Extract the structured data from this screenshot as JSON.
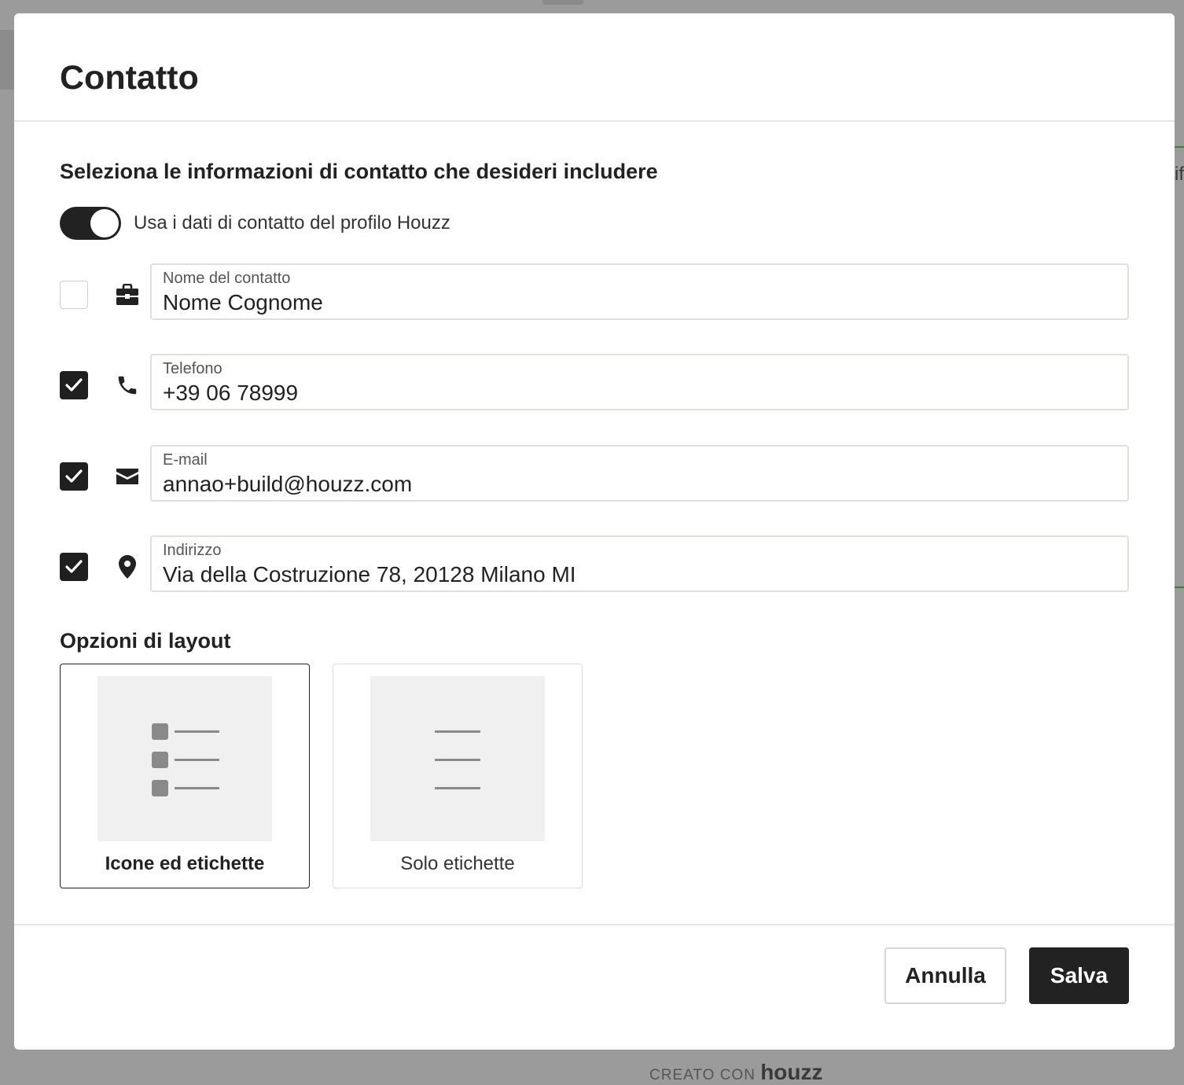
{
  "background": {
    "side_text": "if",
    "footer_prefix": "CREATO CON",
    "footer_brand": "houzz"
  },
  "modal": {
    "title": "Contatto",
    "section_heading": "Seleziona le informazioni di contatto che desideri includere",
    "toggle": {
      "label": "Usa i dati di contatto del profilo Houzz",
      "on": true
    },
    "fields": [
      {
        "label": "Nome del contatto",
        "value": "Nome Cognome",
        "checked": false,
        "icon": "briefcase-icon"
      },
      {
        "label": "Telefono",
        "value": "+39 06 78999",
        "checked": true,
        "icon": "phone-icon"
      },
      {
        "label": "E-mail",
        "value": "annao+build@houzz.com",
        "checked": true,
        "icon": "envelope-icon"
      },
      {
        "label": "Indirizzo",
        "value": "Via della Costruzione 78, 20128 Milano MI",
        "checked": true,
        "icon": "location-pin-icon"
      }
    ],
    "layout": {
      "heading": "Opzioni di layout",
      "options": [
        {
          "label": "Icone ed etichette",
          "selected": true
        },
        {
          "label": "Solo etichette",
          "selected": false
        }
      ]
    },
    "footer": {
      "cancel_label": "Annulla",
      "save_label": "Salva"
    }
  },
  "colors": {
    "overlay": "#9b9b9b",
    "primary": "#222222",
    "border": "#e0e0dc",
    "thumb_bg": "#f0f0f0"
  }
}
